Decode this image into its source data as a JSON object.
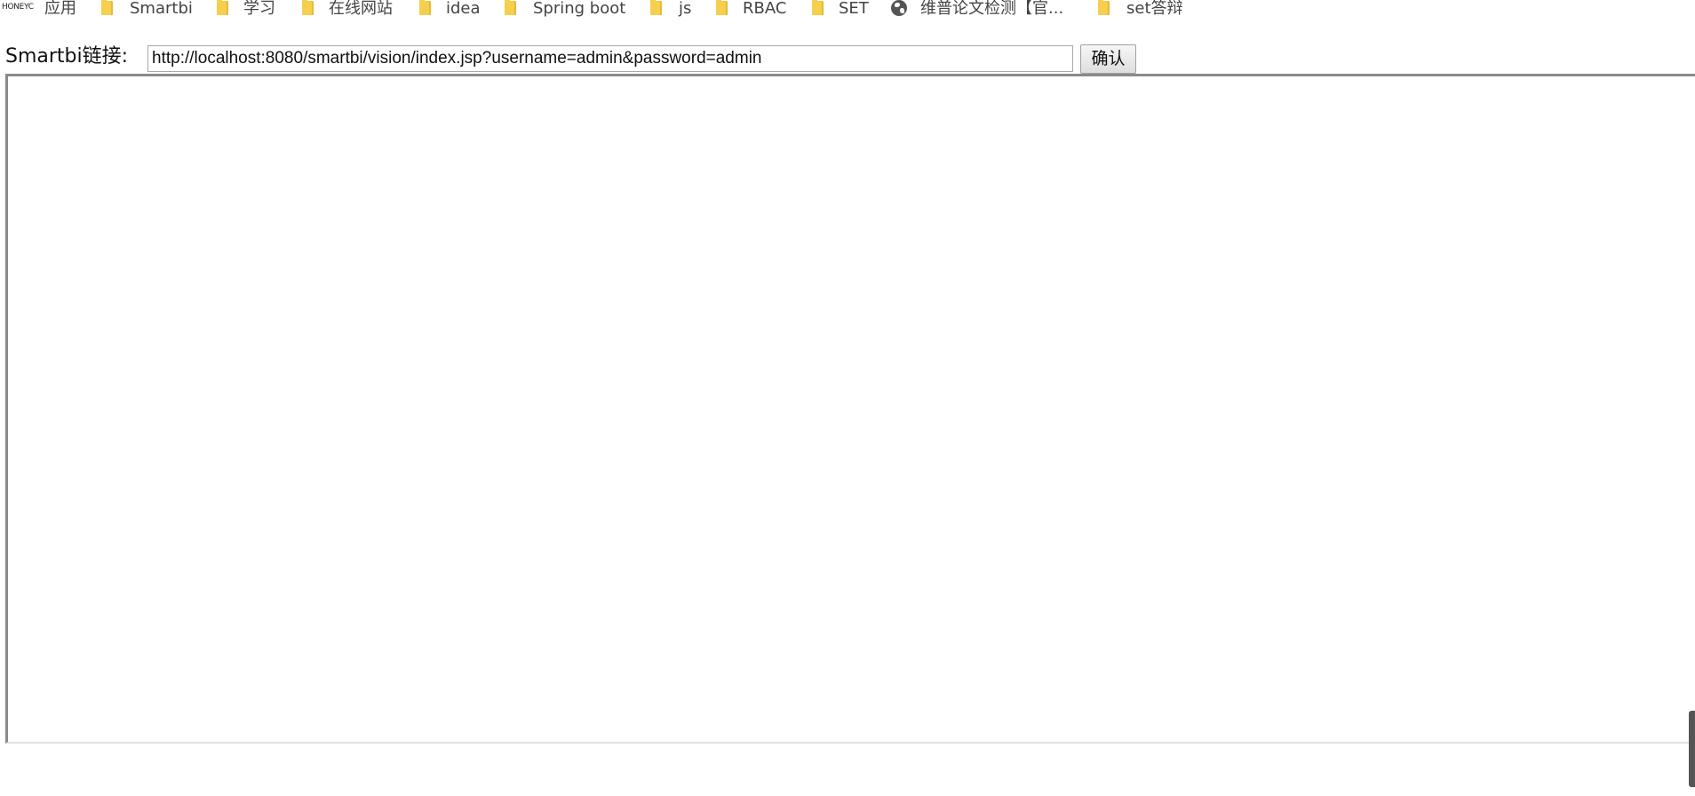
{
  "bookmarks_bar": {
    "apps_icon_text": "HONEYCOMB",
    "items": [
      {
        "label": "应用",
        "icon": "apps-grid-icon"
      },
      {
        "label": "Smartbi",
        "icon": "folder-icon"
      },
      {
        "label": "学习",
        "icon": "folder-icon"
      },
      {
        "label": "在线网站",
        "icon": "folder-icon"
      },
      {
        "label": "idea",
        "icon": "folder-icon"
      },
      {
        "label": "Spring boot",
        "icon": "folder-icon"
      },
      {
        "label": "js",
        "icon": "folder-icon"
      },
      {
        "label": "RBAC",
        "icon": "folder-icon"
      },
      {
        "label": "SET",
        "icon": "folder-icon"
      },
      {
        "label": "维普论文检测【官...",
        "icon": "globe-icon"
      },
      {
        "label": "set答辩",
        "icon": "folder-icon"
      }
    ]
  },
  "form": {
    "label": "Smartbi链接:",
    "url_value": "http://localhost:8080/smartbi/vision/index.jsp?username=admin&password=admin",
    "confirm_label": "确认"
  },
  "colors": {
    "folder": "#f6cf4d",
    "frame_border": "#8a8a8a"
  }
}
